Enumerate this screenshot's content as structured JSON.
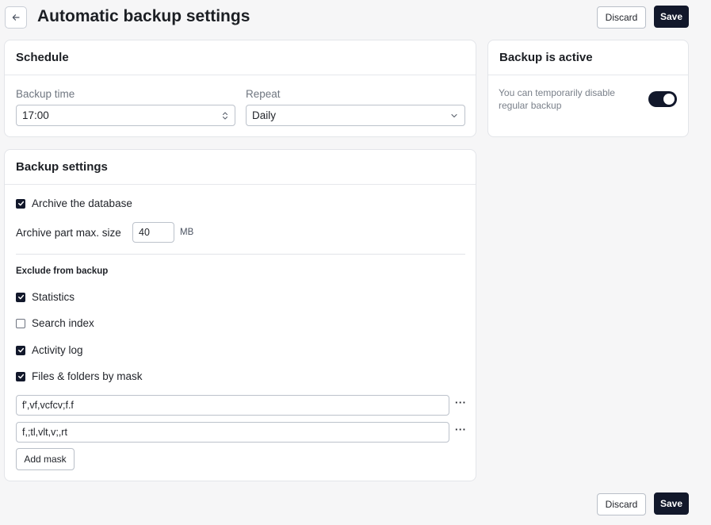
{
  "header": {
    "title": "Automatic backup settings",
    "discard_label": "Discard",
    "save_label": "Save"
  },
  "schedule": {
    "title": "Schedule",
    "time_label": "Backup time",
    "time_value": "17:00",
    "repeat_label": "Repeat",
    "repeat_value": "Daily"
  },
  "backup_active": {
    "title": "Backup is active",
    "description": "You can temporarily disable regular backup",
    "enabled": true
  },
  "backup_settings": {
    "title": "Backup settings",
    "archive_db": {
      "label": "Archive the database",
      "checked": true
    },
    "part_size": {
      "label": "Archive part max. size",
      "value": "40",
      "unit": "MB"
    },
    "exclude_heading": "Exclude from backup",
    "exclude_items": [
      {
        "label": "Statistics",
        "checked": true
      },
      {
        "label": "Search index",
        "checked": false
      },
      {
        "label": "Activity log",
        "checked": true
      },
      {
        "label": "Files & folders by mask",
        "checked": true
      }
    ],
    "masks": [
      "f',vf,vcfcv;f.f",
      "f,;tl,vlt,v;,rt"
    ],
    "add_mask_label": "Add mask"
  },
  "footer": {
    "discard_label": "Discard",
    "save_label": "Save"
  }
}
